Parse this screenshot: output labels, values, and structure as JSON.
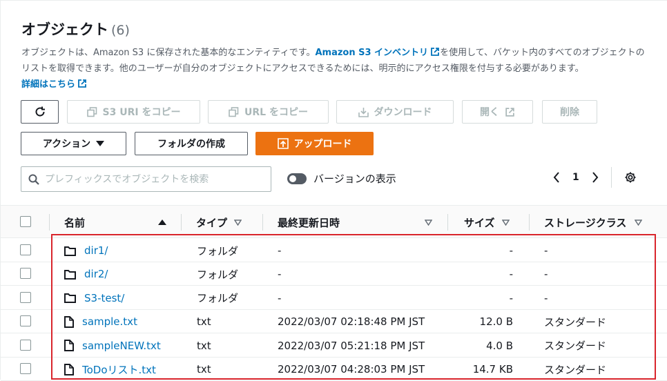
{
  "header": {
    "title": "オブジェクト",
    "count": "(6)",
    "desc_part1": "オブジェクトは、Amazon S3 に保存された基本的なエンティティです。",
    "desc_link": "Amazon S3 インベントリ",
    "desc_part2": "を使用して、バケット内のすべてのオブジェクトのリストを取得できます。他のユーザーが自分のオブジェクトにアクセスできるためには、明示的にアクセス権限を付与する必要があります。",
    "learn_more": "詳細はこちら"
  },
  "toolbar": {
    "copy_s3_uri": "S3 URI をコピー",
    "copy_url": "URL をコピー",
    "download": "ダウンロード",
    "open": "開く",
    "delete": "削除",
    "actions": "アクション",
    "create_folder": "フォルダの作成",
    "upload": "アップロード"
  },
  "search": {
    "placeholder": "プレフィックスでオブジェクトを検索"
  },
  "versions_toggle": {
    "label": "バージョンの表示"
  },
  "pagination": {
    "current": "1"
  },
  "table": {
    "columns": {
      "name": "名前",
      "type": "タイプ",
      "last_modified": "最終更新日時",
      "size": "サイズ",
      "storage_class": "ストレージクラス"
    },
    "rows": [
      {
        "name": "dir1/",
        "kind": "folder",
        "type": "フォルダ",
        "modified": "-",
        "size": "-",
        "storage": "-"
      },
      {
        "name": "dir2/",
        "kind": "folder",
        "type": "フォルダ",
        "modified": "-",
        "size": "-",
        "storage": "-"
      },
      {
        "name": "S3-test/",
        "kind": "folder",
        "type": "フォルダ",
        "modified": "-",
        "size": "-",
        "storage": "-"
      },
      {
        "name": "sample.txt",
        "kind": "file",
        "type": "txt",
        "modified": "2022/03/07 02:18:48 PM JST",
        "size": "12.0 B",
        "storage": "スタンダード"
      },
      {
        "name": "sampleNEW.txt",
        "kind": "file",
        "type": "txt",
        "modified": "2022/03/07 05:21:18 PM JST",
        "size": "4.0 B",
        "storage": "スタンダード"
      },
      {
        "name": "ToDoリスト.txt",
        "kind": "file",
        "type": "txt",
        "modified": "2022/03/07 04:28:03 PM JST",
        "size": "14.7 KB",
        "storage": "スタンダード"
      }
    ]
  },
  "colors": {
    "link": "#0073bb",
    "primary": "#ec7211",
    "highlight": "#d9242b"
  }
}
